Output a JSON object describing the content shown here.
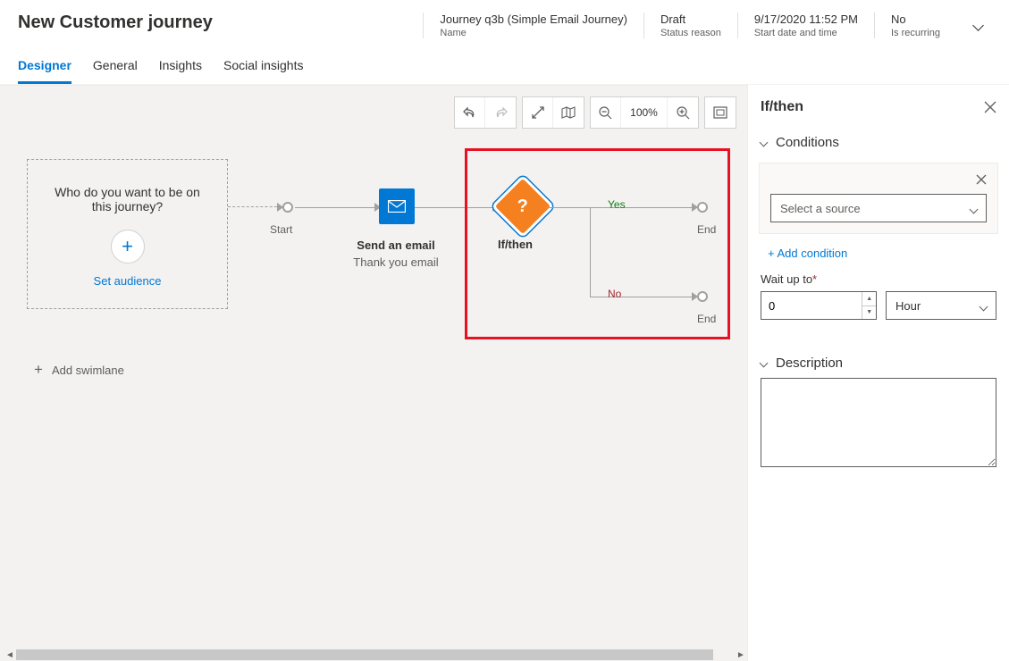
{
  "header": {
    "title": "New Customer journey",
    "meta": [
      {
        "value": "Journey q3b (Simple Email Journey)",
        "label": "Name"
      },
      {
        "value": "Draft",
        "label": "Status reason"
      },
      {
        "value": "9/17/2020 11:52 PM",
        "label": "Start date and time"
      },
      {
        "value": "No",
        "label": "Is recurring"
      }
    ]
  },
  "tabs": [
    "Designer",
    "General",
    "Insights",
    "Social insights"
  ],
  "toolbar": {
    "zoom": "100%"
  },
  "canvas": {
    "audience_prompt": "Who do you want to be on this journey?",
    "set_audience": "Set audience",
    "start": "Start",
    "email_title": "Send an email",
    "email_subtitle": "Thank you email",
    "ifthen": "If/then",
    "yes": "Yes",
    "no": "No",
    "end": "End",
    "add_swimlane": "Add swimlane"
  },
  "panel": {
    "title": "If/then",
    "sections": {
      "conditions": "Conditions",
      "description": "Description"
    },
    "select_source_placeholder": "Select a source",
    "add_condition": "+ Add condition",
    "wait_label": "Wait up to",
    "wait_value": "0",
    "wait_unit": "Hour",
    "description_value": ""
  }
}
